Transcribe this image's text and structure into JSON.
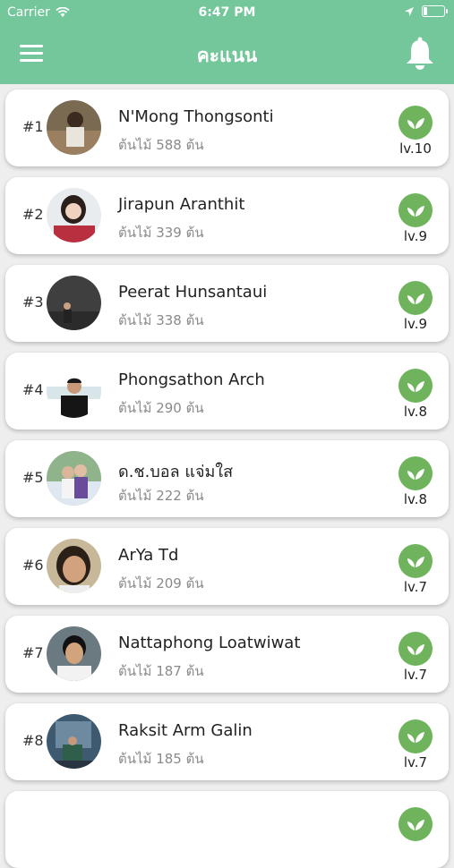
{
  "status_bar": {
    "carrier": "Carrier",
    "time": "6:47 PM"
  },
  "header": {
    "title": "คะแนน"
  },
  "leaderboard": [
    {
      "rank": "#1",
      "name": "N'Mong Thongsonti",
      "trees": "ต้นไม้ 588 ต้น",
      "level": "lv.10"
    },
    {
      "rank": "#2",
      "name": "Jirapun Aranthit",
      "trees": "ต้นไม้ 339 ต้น",
      "level": "lv.9"
    },
    {
      "rank": "#3",
      "name": "Peerat Hunsantaui",
      "trees": "ต้นไม้ 338 ต้น",
      "level": "lv.9"
    },
    {
      "rank": "#4",
      "name": "Phongsathon Arch",
      "trees": "ต้นไม้ 290 ต้น",
      "level": "lv.8"
    },
    {
      "rank": "#5",
      "name": "ด.ช.บอล แจ่มใส",
      "trees": "ต้นไม้ 222 ต้น",
      "level": "lv.8"
    },
    {
      "rank": "#6",
      "name": "ArYa Td",
      "trees": "ต้นไม้ 209 ต้น",
      "level": "lv.7"
    },
    {
      "rank": "#7",
      "name": "Nattaphong Loatwiwat",
      "trees": "ต้นไม้ 187 ต้น",
      "level": "lv.7"
    },
    {
      "rank": "#8",
      "name": "Raksit Arm Galin",
      "trees": "ต้นไม้ 185 ต้น",
      "level": "lv.7"
    }
  ],
  "colors": {
    "header": "#74c69b",
    "level_badge": "#6fb35d"
  }
}
